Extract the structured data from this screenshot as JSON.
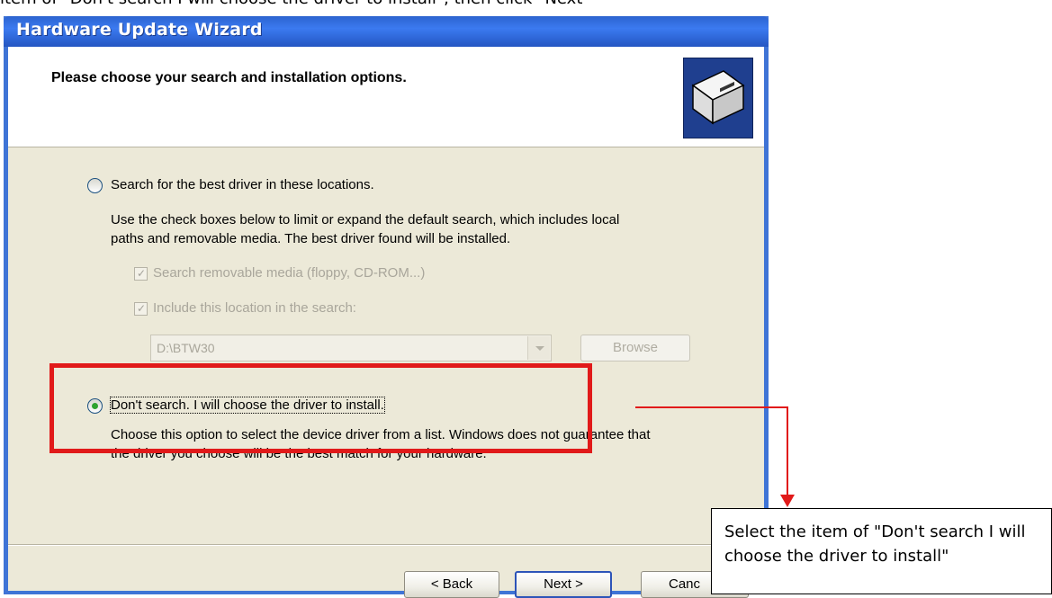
{
  "caption": {
    "text": "item of \"Don't search I will choose the driver to install\", then click \"Next\""
  },
  "window": {
    "title": "Hardware Update Wizard"
  },
  "header": {
    "heading": "Please choose your search and installation options.",
    "icon": "hardware-wizard-icon"
  },
  "option_search": {
    "label": "Search for the best driver in these locations.",
    "selected": false,
    "description_line1": "Use the check boxes below to limit or expand the default search, which includes local",
    "description_line2": "paths and removable media. The best driver found will be installed.",
    "check_removable_label": "Search removable media (floppy, CD-ROM...)",
    "check_removable_checked": true,
    "check_location_label": "Include this location in the search:",
    "check_location_checked": true,
    "location_value": "D:\\BTW30",
    "browse_label": "Browse"
  },
  "option_manual": {
    "label": "Don't search. I will choose the driver to install.",
    "selected": true,
    "description_line1": "Choose this option to select the device driver from a list.  Windows does not guarantee that",
    "description_line2": "the driver you choose will be the best match for your hardware."
  },
  "buttons": {
    "back": "< Back",
    "next": "Next >",
    "cancel": "Canc"
  },
  "annotation": {
    "note": "Select the item of \"Don't search I will choose the driver to install\"",
    "highlight_color": "#e11a1a"
  }
}
